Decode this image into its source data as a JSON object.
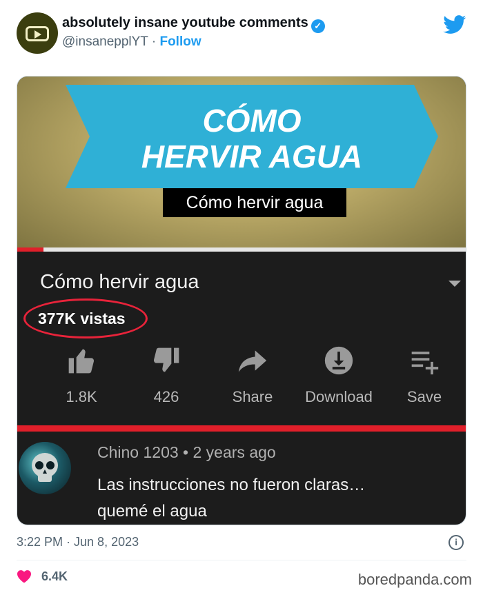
{
  "tweet": {
    "display_name": "absolutely insane youtube comments",
    "handle": "@insanepplYT",
    "separator": "·",
    "follow_label": "Follow",
    "timestamp": "3:22 PM · Jun 8, 2023",
    "likes_count": "6.4K",
    "accent_color": "#1d9bf0",
    "icons": [
      "youtube-logo-icon",
      "verified-badge-icon",
      "twitter-bird-icon",
      "info-icon",
      "heart-icon"
    ]
  },
  "embedded": {
    "banner_title_line1": "CÓMO",
    "banner_title_line2": "HERVIR AGUA",
    "caption": "Cómo hervir agua",
    "video_title": "Cómo hervir agua",
    "views": "377K vistas",
    "actions": [
      {
        "label": "1.8K",
        "icon": "like-icon"
      },
      {
        "label": "426",
        "icon": "dislike-icon"
      },
      {
        "label": "Share",
        "icon": "share-icon"
      },
      {
        "label": "Download",
        "icon": "download-icon"
      },
      {
        "label": "Save",
        "icon": "save-to-playlist-icon"
      }
    ],
    "comment": {
      "author": "Chino 1203",
      "time": "2 years ago",
      "line1": "Las instrucciones no fueron claras…",
      "line2": "quemé el agua"
    },
    "accent_red": "#e01f2a",
    "banner_color": "#2fb0d6"
  },
  "watermark": "boredpanda.com"
}
